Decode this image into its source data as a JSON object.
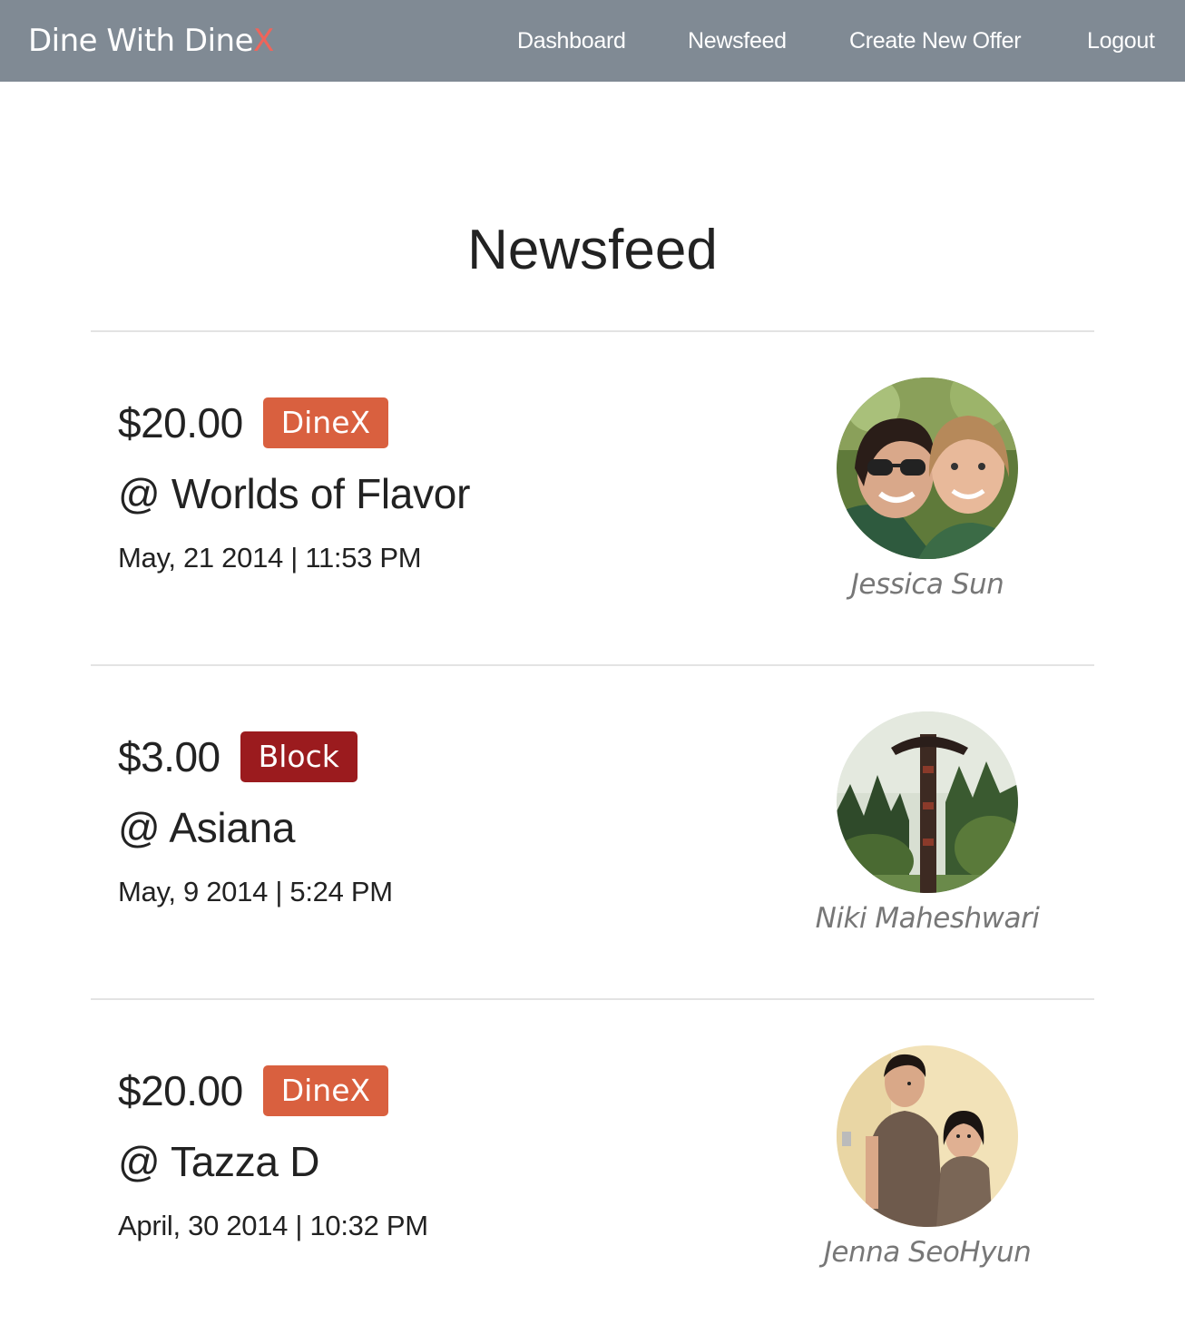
{
  "navbar": {
    "brand_main": "Dine With Dine",
    "brand_accent": "X",
    "links": {
      "dashboard": "Dashboard",
      "newsfeed": "Newsfeed",
      "create_offer": "Create New Offer",
      "logout": "Logout"
    },
    "accent_color": "#f0645a",
    "background_color": "#808a94"
  },
  "page": {
    "title": "Newsfeed"
  },
  "offers": [
    {
      "price": "$20.00",
      "type": "DineX",
      "restaurant": "@ Worlds of Flavor",
      "datetime": "May, 21 2014 | 11:53 PM",
      "user": "Jessica Sun",
      "badge_color": "#d9603f"
    },
    {
      "price": "$3.00",
      "type": "Block",
      "restaurant": "@ Asiana",
      "datetime": "May, 9 2014 | 5:24 PM",
      "user": "Niki Maheshwari",
      "badge_color": "#9b1b1e"
    },
    {
      "price": "$20.00",
      "type": "DineX",
      "restaurant": "@ Tazza D",
      "datetime": "April, 30 2014 | 10:32 PM",
      "user": "Jenna SeoHyun",
      "badge_color": "#d9603f"
    }
  ]
}
